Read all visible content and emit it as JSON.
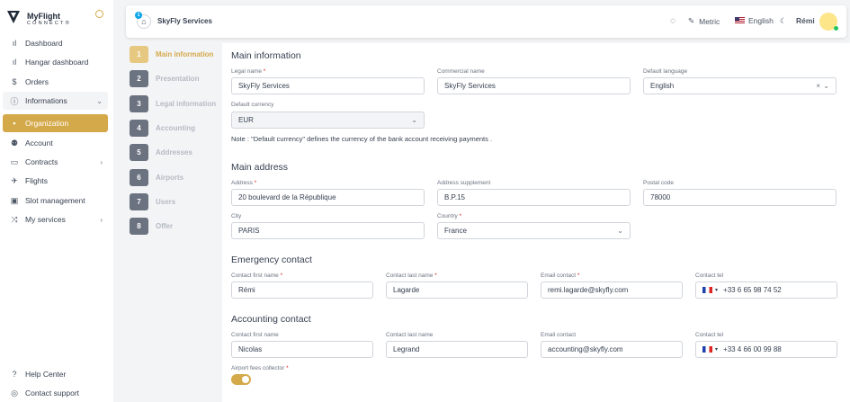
{
  "brand": {
    "line1": "MyFlight",
    "line2": "CONNECT®"
  },
  "nav": [
    {
      "icon": "bar-chart-icon",
      "glyph": "ıl",
      "label": "Dashboard"
    },
    {
      "icon": "bar-chart-icon",
      "glyph": "ıl",
      "label": "Hangar dashboard"
    },
    {
      "icon": "dollar-icon",
      "glyph": "$",
      "label": "Orders"
    },
    {
      "icon": "info-icon",
      "glyph": "ⓘ",
      "label": "Informations"
    },
    {
      "icon": "building-icon",
      "glyph": "▪",
      "label": "Organization"
    },
    {
      "icon": "user-icon",
      "glyph": "⚉",
      "label": "Account"
    },
    {
      "icon": "folder-icon",
      "glyph": "▭",
      "label": "Contracts"
    },
    {
      "icon": "plane-icon",
      "glyph": "✈",
      "label": "Flights"
    },
    {
      "icon": "slot-icon",
      "glyph": "▣",
      "label": "Slot management"
    },
    {
      "icon": "services-icon",
      "glyph": "⤨",
      "label": "My services"
    }
  ],
  "footer": {
    "help": "Help Center",
    "support": "Contact support"
  },
  "topbar": {
    "badge": "1",
    "company": "SkyFly Services",
    "unit": "Metric",
    "language": "English",
    "user": "Rémi"
  },
  "steps": [
    {
      "num": "1",
      "label": "Main information"
    },
    {
      "num": "2",
      "label": "Presentation"
    },
    {
      "num": "3",
      "label": "Legal information"
    },
    {
      "num": "4",
      "label": "Accounting"
    },
    {
      "num": "5",
      "label": "Addresses"
    },
    {
      "num": "6",
      "label": "Airports"
    },
    {
      "num": "7",
      "label": "Users"
    },
    {
      "num": "8",
      "label": "Offer"
    }
  ],
  "main_info": {
    "title": "Main information",
    "legal_name_label": "Legal name",
    "legal_name": "SkyFly Services",
    "commercial_name_label": "Commercial name",
    "commercial_name": "SkyFly Services",
    "language_label": "Default language",
    "language": "English",
    "currency_label": "Default currency",
    "currency": "EUR",
    "note": "Note : \"Default currency\" defines the currency of the bank account receiving payments ."
  },
  "address": {
    "title": "Main address",
    "address_label": "Address",
    "address": "20 boulevard de la République",
    "supplement_label": "Address supplement",
    "supplement": "B.P.15",
    "postal_label": "Postal code",
    "postal": "78000",
    "city_label": "City",
    "city": "PARIS",
    "country_label": "Country",
    "country": "France"
  },
  "emergency": {
    "title": "Emergency contact",
    "first_label": "Contact first name",
    "first": "Rémi",
    "last_label": "Contact last name",
    "last": "Lagarde",
    "email_label": "Email contact",
    "email": "remi.lagarde@skyfly.com",
    "tel_label": "Contact tel",
    "tel": "+33 6 65 98 74 52"
  },
  "accounting": {
    "title": "Accounting contact",
    "first_label": "Contact first name",
    "first": "Nicolas",
    "last_label": "Contact last name",
    "last": "Legrand",
    "email_label": "Email contact",
    "email": "accounting@skyfly.com",
    "tel_label": "Contact tel",
    "tel": "+33 4 66 00 99 88",
    "collector_label": "Airport fees collector"
  },
  "required_mark": "*",
  "colors": {
    "accent": "#d4a94a",
    "required": "#dc2626"
  }
}
